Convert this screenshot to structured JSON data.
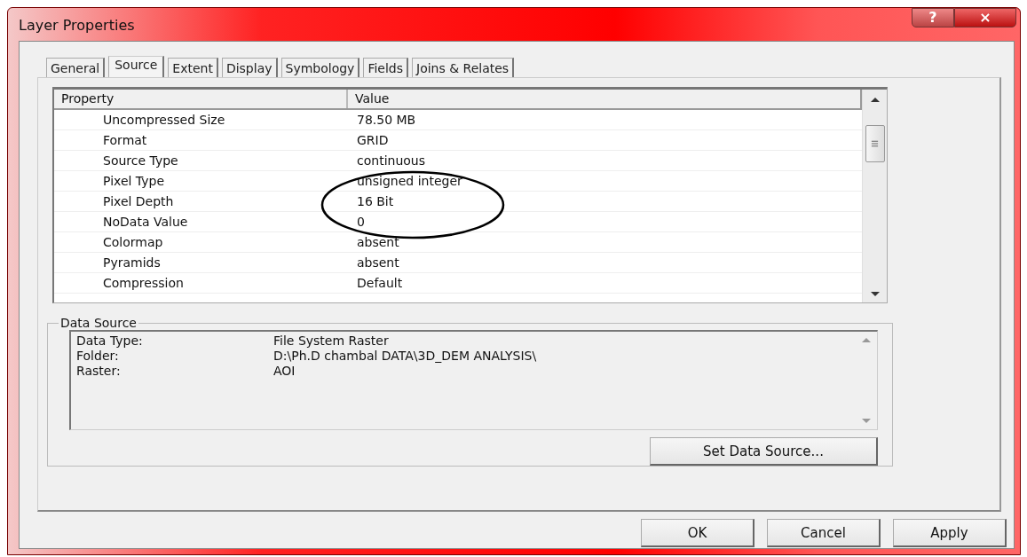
{
  "window": {
    "title": "Layer Properties",
    "controls": [
      {
        "kind": "help",
        "label": "?"
      },
      {
        "kind": "close",
        "label": "×"
      }
    ]
  },
  "tabs": [
    {
      "label": "General",
      "selected": false
    },
    {
      "label": "Source",
      "selected": true
    },
    {
      "label": "Extent",
      "selected": false
    },
    {
      "label": "Display",
      "selected": false
    },
    {
      "label": "Symbology",
      "selected": false
    },
    {
      "label": "Fields",
      "selected": false
    },
    {
      "label": "Joins & Relates",
      "selected": false
    }
  ],
  "property_table": {
    "columns": [
      "Property",
      "Value"
    ],
    "rows": [
      {
        "property": "Uncompressed Size",
        "value": "78.50 MB"
      },
      {
        "property": "Format",
        "value": "GRID"
      },
      {
        "property": "Source Type",
        "value": "continuous"
      },
      {
        "property": "Pixel Type",
        "value": "unsigned integer"
      },
      {
        "property": "Pixel Depth",
        "value": "16 Bit"
      },
      {
        "property": "NoData Value",
        "value": "0"
      },
      {
        "property": "Colormap",
        "value": "absent"
      },
      {
        "property": "Pyramids",
        "value": "absent"
      },
      {
        "property": "Compression",
        "value": "Default"
      }
    ],
    "annotations": [
      {
        "kind": "ellipse"
      }
    ]
  },
  "data_source": {
    "title": "Data Source",
    "lines": [
      {
        "label": "Data Type:",
        "value": "File System Raster"
      },
      {
        "label": "Folder:",
        "value": "D:\\Ph.D chambal  DATA\\3D_DEM ANALYSIS\\"
      },
      {
        "label": "Raster:",
        "value": "AOI"
      }
    ],
    "button": "Set Data Source..."
  },
  "buttons": [
    "OK",
    "Cancel",
    "Apply"
  ]
}
